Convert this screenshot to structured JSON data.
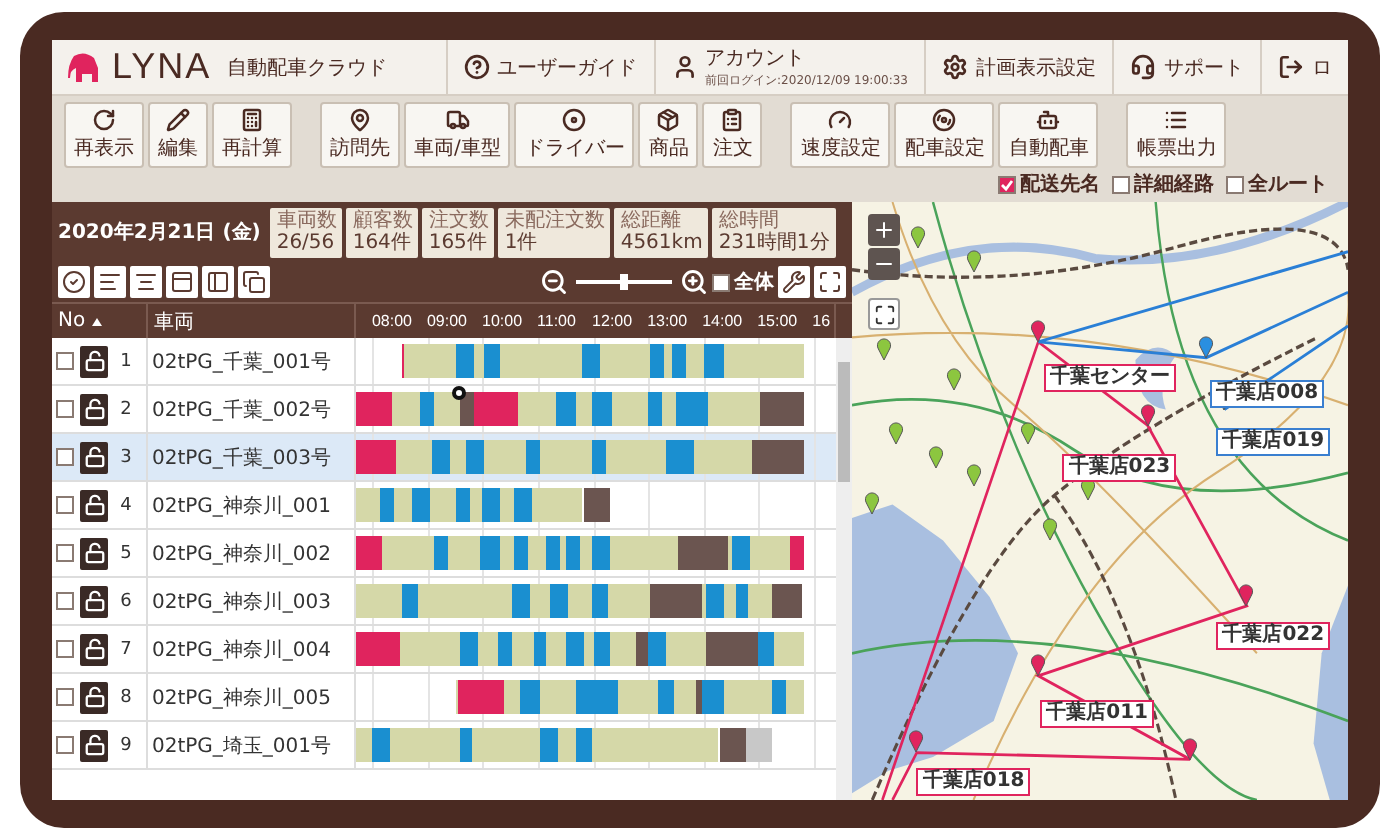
{
  "header": {
    "logo_text": "LYNA",
    "app_name": "自動配車クラウド",
    "nav": [
      {
        "label": "ユーザーガイド"
      },
      {
        "label": "アカウント",
        "sub": "前回ログイン:2020/12/09 19:00:33"
      },
      {
        "label": "計画表示設定"
      },
      {
        "label": "サポート"
      },
      {
        "label": "ロ"
      }
    ]
  },
  "toolbar": {
    "groups": [
      [
        "再表示",
        "編集",
        "再計算"
      ],
      [
        "訪問先",
        "車両/車型",
        "ドライバー",
        "商品",
        "注文"
      ],
      [
        "速度設定",
        "配車設定",
        "自動配車"
      ],
      [
        "帳票出力"
      ]
    ]
  },
  "map_options": [
    {
      "label": "配送先名",
      "checked": true
    },
    {
      "label": "詳細経路",
      "checked": false
    },
    {
      "label": "全ルート",
      "checked": false
    }
  ],
  "plan": {
    "date": "2020年2月21日 (金)",
    "stats": [
      {
        "label": "車両数",
        "value": "26/56"
      },
      {
        "label": "顧客数",
        "value": "164件"
      },
      {
        "label": "注文数",
        "value": "165件"
      },
      {
        "label": "未配注文数",
        "value": "1件"
      },
      {
        "label": "総距離",
        "value": "4561km"
      },
      {
        "label": "総時間",
        "value": "231時間1分"
      }
    ]
  },
  "timeline_controls": {
    "zoom": {
      "level": 0.5
    },
    "whole": {
      "label": "全体",
      "checked": false
    }
  },
  "table": {
    "columns": [
      "No",
      "車両"
    ],
    "times": [
      "08:00",
      "09:00",
      "10:00",
      "11:00",
      "12:00",
      "13:00",
      "14:00",
      "15:00",
      "16"
    ],
    "rows": [
      {
        "no": "1",
        "vehicle": "02tPG_千葉_001号",
        "checked": false,
        "selected": false
      },
      {
        "no": "2",
        "vehicle": "02tPG_千葉_002号",
        "checked": false,
        "selected": false
      },
      {
        "no": "3",
        "vehicle": "02tPG_千葉_003号",
        "checked": false,
        "selected": true
      },
      {
        "no": "4",
        "vehicle": "02tPG_神奈川_001",
        "checked": false,
        "selected": false
      },
      {
        "no": "5",
        "vehicle": "02tPG_神奈川_002",
        "checked": false,
        "selected": false
      },
      {
        "no": "6",
        "vehicle": "02tPG_神奈川_003",
        "checked": false,
        "selected": false
      },
      {
        "no": "7",
        "vehicle": "02tPG_神奈川_004",
        "checked": false,
        "selected": false
      },
      {
        "no": "8",
        "vehicle": "02tPG_神奈川_005",
        "checked": false,
        "selected": false
      },
      {
        "no": "9",
        "vehicle": "02tPG_埼玉_001号",
        "checked": false,
        "selected": false
      }
    ]
  },
  "map": {
    "labels": [
      {
        "text": "千葉センター",
        "color": "#e0245e"
      },
      {
        "text": "千葉店008",
        "color": "#3a7fd0"
      },
      {
        "text": "千葉店019",
        "color": "#3a7fd0"
      },
      {
        "text": "千葉店023",
        "color": "#e0245e"
      },
      {
        "text": "千葉店022",
        "color": "#e0245e"
      },
      {
        "text": "千葉店011",
        "color": "#e0245e"
      },
      {
        "text": "千葉店018",
        "color": "#e0245e"
      }
    ]
  }
}
